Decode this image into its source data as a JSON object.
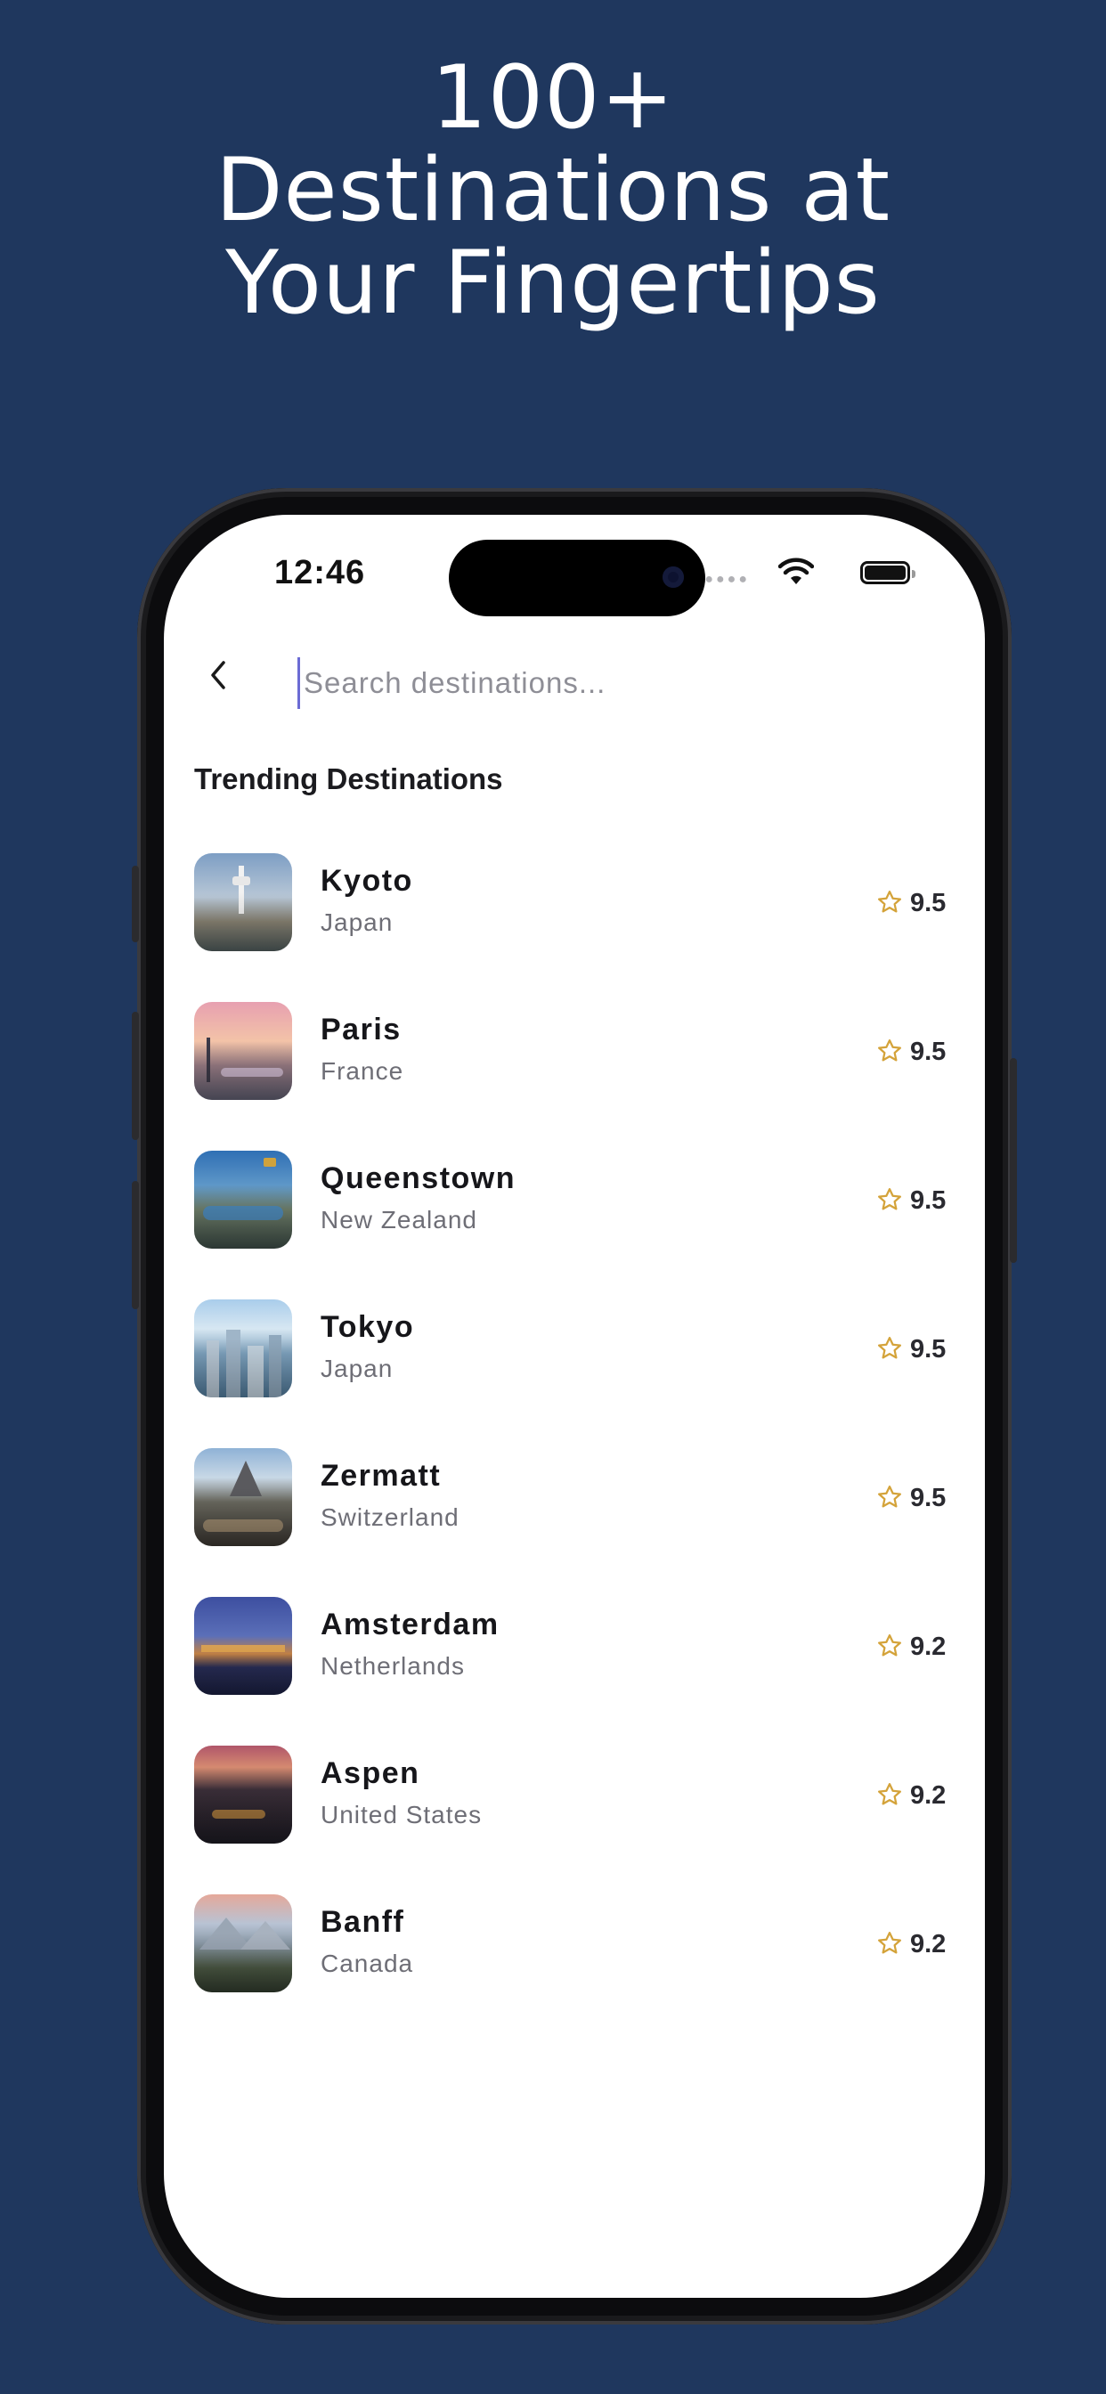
{
  "headline": {
    "line1": "100+",
    "line2": "Destinations at",
    "line3": "Your Fingertips"
  },
  "status_bar": {
    "time": "12:46",
    "icons": [
      "signal-dots-icon",
      "wifi-icon",
      "battery-icon"
    ]
  },
  "search": {
    "placeholder": "Search destinations...",
    "value": ""
  },
  "back_icon": "chevron-left-icon",
  "section_title": "Trending Destinations",
  "rating_icon": "star-outline-icon",
  "colors": {
    "background": "#1f375e",
    "star": "#d4a33a",
    "cursor": "#6b6bd4"
  },
  "destinations": [
    {
      "name": "Kyoto",
      "country": "Japan",
      "rating": "9.5"
    },
    {
      "name": "Paris",
      "country": "France",
      "rating": "9.5"
    },
    {
      "name": "Queenstown",
      "country": "New Zealand",
      "rating": "9.5"
    },
    {
      "name": "Tokyo",
      "country": "Japan",
      "rating": "9.5"
    },
    {
      "name": "Zermatt",
      "country": "Switzerland",
      "rating": "9.5"
    },
    {
      "name": "Amsterdam",
      "country": "Netherlands",
      "rating": "9.2"
    },
    {
      "name": "Aspen",
      "country": "United States",
      "rating": "9.2"
    },
    {
      "name": "Banff",
      "country": "Canada",
      "rating": "9.2"
    }
  ]
}
